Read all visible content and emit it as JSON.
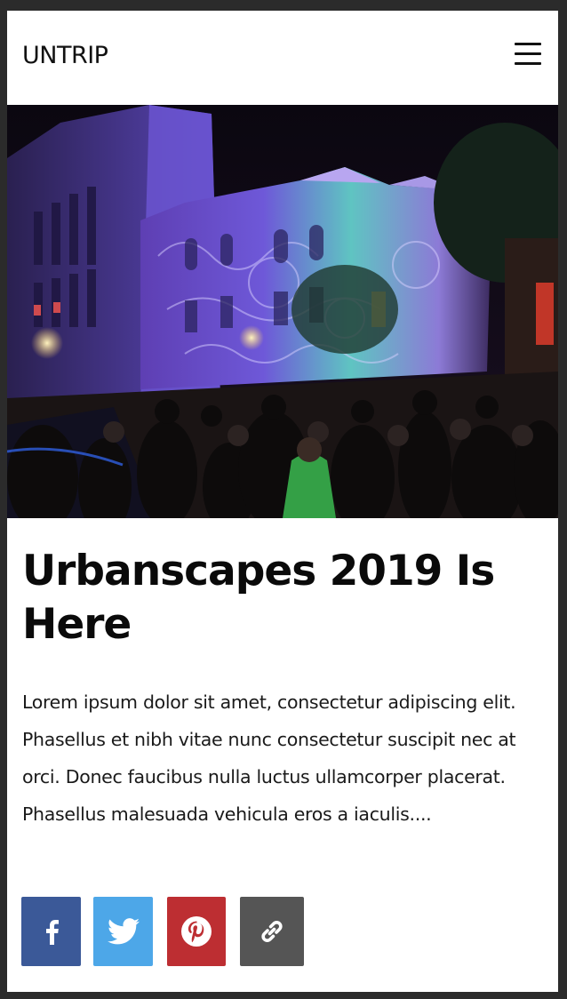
{
  "header": {
    "logo": "UNTRIP",
    "menu_icon": "hamburger-icon"
  },
  "hero": {
    "image": "night-festival-building-projection"
  },
  "article": {
    "title": "Urbanscapes 2019 Is Here",
    "excerpt": "Lorem ipsum dolor sit amet, consectetur adipiscing elit. Phasellus et nibh vitae nunc consectetur suscipit nec at orci. Donec faucibus nulla luctus ullamcorper placerat. Phasellus malesuada vehicula eros a iaculis...."
  },
  "share": [
    {
      "icon": "facebook-icon",
      "color": "#3b5998"
    },
    {
      "icon": "twitter-icon",
      "color": "#4da7e8"
    },
    {
      "icon": "pinterest-icon",
      "color": "#bd2e32"
    },
    {
      "icon": "link-icon",
      "color": "#555555"
    }
  ]
}
